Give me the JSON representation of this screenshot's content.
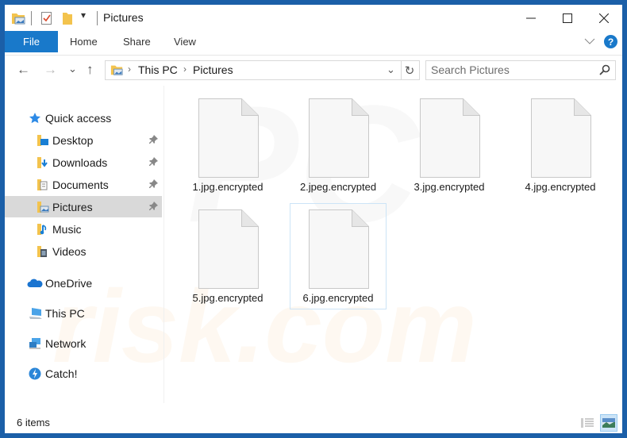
{
  "window": {
    "title": "Pictures",
    "controls": {
      "minimize": "—",
      "maximize": "☐",
      "close": "✕"
    }
  },
  "quick_access_toolbar": {
    "items": [
      "properties-icon",
      "new-folder-icon"
    ],
    "dropdown": "▾"
  },
  "ribbon": {
    "file_tab": "File",
    "tabs": [
      "Home",
      "Share",
      "View"
    ],
    "expand_icon": "﹀",
    "help_icon": "?"
  },
  "nav": {
    "back": "←",
    "forward": "→",
    "recent": "⌄",
    "up": "↑",
    "breadcrumb": [
      "This PC",
      "Pictures"
    ],
    "separator": "›",
    "dropdown": "⌄",
    "refresh": "↻",
    "search_placeholder": "Search Pictures",
    "search_value": ""
  },
  "sidebar": {
    "quick_access": "Quick access",
    "pinned": [
      {
        "label": "Desktop",
        "icon": "desktop-folder-icon",
        "pinned": true
      },
      {
        "label": "Downloads",
        "icon": "downloads-folder-icon",
        "pinned": true
      },
      {
        "label": "Documents",
        "icon": "documents-folder-icon",
        "pinned": true
      },
      {
        "label": "Pictures",
        "icon": "pictures-folder-icon",
        "pinned": true,
        "selected": true
      },
      {
        "label": "Music",
        "icon": "music-folder-icon",
        "pinned": false
      },
      {
        "label": "Videos",
        "icon": "videos-folder-icon",
        "pinned": false
      }
    ],
    "locations": [
      {
        "label": "OneDrive",
        "icon": "onedrive-icon"
      },
      {
        "label": "This PC",
        "icon": "this-pc-icon"
      },
      {
        "label": "Network",
        "icon": "network-icon"
      },
      {
        "label": "Catch!",
        "icon": "catch-icon"
      }
    ],
    "pin_glyph": "📌"
  },
  "files": [
    {
      "name": "1.jpg.encrypted"
    },
    {
      "name": "2.jpeg.encrypted"
    },
    {
      "name": "3.jpg.encrypted"
    },
    {
      "name": "4.jpg.encrypted"
    },
    {
      "name": "5.jpg.encrypted"
    },
    {
      "name": "6.jpg.encrypted",
      "selected": true
    }
  ],
  "status": {
    "item_count": "6 items",
    "views": [
      "details-view",
      "large-icons-view"
    ],
    "active_view": "large-icons-view"
  },
  "watermark": {
    "line1": "PC",
    "line2": "risk.com"
  },
  "colors": {
    "accent": "#1979ca",
    "frame": "#1b5fa8",
    "selection": "#cce4f7",
    "nav_selected": "#d9d9d9"
  }
}
